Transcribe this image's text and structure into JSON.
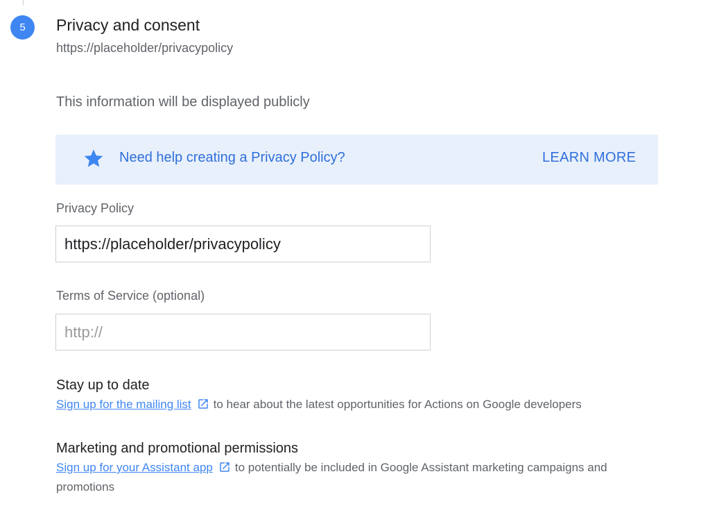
{
  "step": {
    "number": "5",
    "title": "Privacy and consent",
    "subtitle": "https://placeholder/privacypolicy"
  },
  "info_text": "This information will be displayed publicly",
  "help_banner": {
    "icon": "star-icon",
    "text": "Need help creating a Privacy Policy?",
    "action_label": "LEARN MORE",
    "background": "#e8f0fb",
    "accent": "#2f6fdb"
  },
  "privacy_policy": {
    "label": "Privacy Policy",
    "value": "https://placeholder/privacypolicy"
  },
  "terms_of_service": {
    "label": "Terms of Service (optional)",
    "placeholder": "http://"
  },
  "stay_up_to_date": {
    "heading": "Stay up to date",
    "link_text": "Sign up for the mailing list",
    "link_icon": "external-link-icon",
    "rest_text": "to hear about the latest opportunities for Actions on Google developers"
  },
  "marketing": {
    "heading": "Marketing and promotional permissions",
    "link_text": "Sign up for your Assistant app",
    "link_icon": "external-link-icon",
    "rest_text": "to potentially be included in Google Assistant marketing campaigns and promotions"
  },
  "colors": {
    "primary_blue": "#3f86f2",
    "text_primary": "#202124",
    "text_secondary": "#5f6368"
  }
}
